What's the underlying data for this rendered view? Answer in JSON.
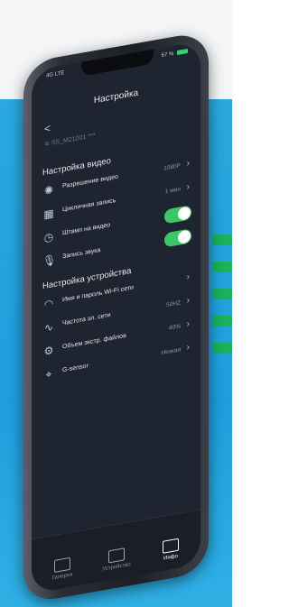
{
  "statusbar": {
    "carrier": "4G LTE",
    "battery": "67 %"
  },
  "nav": {
    "title": "Настройка",
    "back_symbol": "<"
  },
  "ssid": "SS_M21001 ***",
  "video": {
    "header": "Настройка видео",
    "resolution": {
      "label": "Разрешение видео",
      "value": "1080P"
    },
    "loop": {
      "label": "Цикличная запись",
      "value": "1 мин"
    },
    "stamp": {
      "label": "Штамп на видео"
    },
    "audio": {
      "label": "Запись звука"
    }
  },
  "device": {
    "header": "Настройка устройства",
    "wifi": {
      "label": "Имя и пароль Wi-Fi сети"
    },
    "freq": {
      "label": "Частота эл. сети",
      "value": "50HZ"
    },
    "storage": {
      "label": "Объем экстр. файлов",
      "value": "40%"
    },
    "gsensor": {
      "label": "G-sensor",
      "value": "Низкая"
    }
  },
  "tabs": [
    {
      "label": "Галерея"
    },
    {
      "label": "Устройство"
    },
    {
      "label": "Инфо"
    }
  ],
  "colors": {
    "background": "#2aa8df",
    "accent_green": "#19b35a",
    "toggle_on": "#3cc667"
  }
}
